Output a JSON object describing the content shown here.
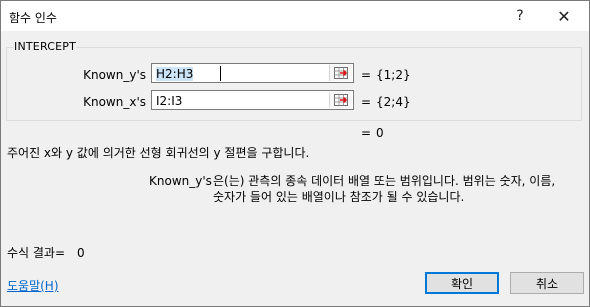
{
  "dialog": {
    "title": "함수 인수",
    "help_glyph": "?",
    "close_glyph": "✕"
  },
  "function_group": {
    "name": "INTERCEPT",
    "args": [
      {
        "label": "Known_y's",
        "value": "H2:H3",
        "eq": "=",
        "result": "{1;2}"
      },
      {
        "label": "Known_x's",
        "value": "I2:I3",
        "eq": "=",
        "result": "{2;4}"
      }
    ],
    "eq": "=",
    "result": "0"
  },
  "description": {
    "main": "주어진 x와 y 값에 의거한 선형 회귀선의 y 절편을 구합니다.",
    "arg_name": "Known_y's",
    "arg_line1": "은(는) 관측의 종속 데이터 배열 또는 범위입니다. 범위는 숫자, 이름,",
    "arg_line2": "숫자가 들어 있는 배열이나 참조가 될 수 있습니다."
  },
  "formula_result": {
    "label": "수식 결과=",
    "value": "0"
  },
  "footer": {
    "help_link": "도움말(H)",
    "ok_label": "확인",
    "cancel_label": "취소"
  },
  "icons": {
    "collapse": "range-selector-icon"
  },
  "colors": {
    "accent": "#0078d7",
    "link": "#0066cc",
    "selection": "#cce4f7"
  }
}
